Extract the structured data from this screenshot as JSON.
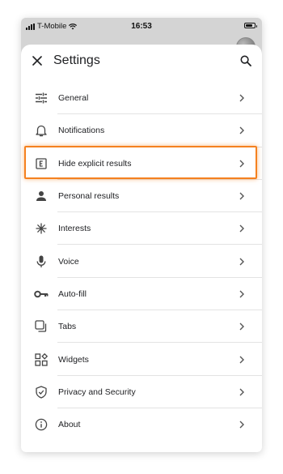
{
  "status_bar": {
    "carrier": "T-Mobile",
    "time": "16:53"
  },
  "header": {
    "title": "Settings",
    "close_icon": "close-icon",
    "search_icon": "search-icon"
  },
  "highlight_color": "#f5811f",
  "settings": {
    "items": [
      {
        "label": "General",
        "icon": "sliders-icon"
      },
      {
        "label": "Notifications",
        "icon": "bell-icon"
      },
      {
        "label": "Hide explicit results",
        "icon": "explicit-icon"
      },
      {
        "label": "Personal results",
        "icon": "person-icon"
      },
      {
        "label": "Interests",
        "icon": "asterisk-icon"
      },
      {
        "label": "Voice",
        "icon": "microphone-icon"
      },
      {
        "label": "Auto-fill",
        "icon": "key-icon"
      },
      {
        "label": "Tabs",
        "icon": "tabs-icon"
      },
      {
        "label": "Widgets",
        "icon": "widgets-icon"
      },
      {
        "label": "Privacy and Security",
        "icon": "shield-icon"
      },
      {
        "label": "About",
        "icon": "info-icon"
      }
    ]
  }
}
